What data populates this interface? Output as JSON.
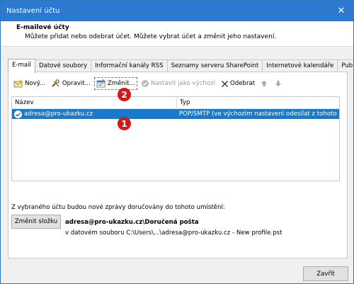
{
  "window": {
    "title": "Nastavení účtu"
  },
  "header": {
    "title": "E-mailové účty",
    "subtitle": "Můžete přidat nebo odebrat účet. Můžete vybrat účet a změnit jeho nastavení."
  },
  "tabs": [
    {
      "label": "E-mail",
      "active": true
    },
    {
      "label": "Datové soubory"
    },
    {
      "label": "Informační kanály RSS"
    },
    {
      "label": "Seznamy serveru SharePoint"
    },
    {
      "label": "Internetové kalendáře"
    },
    {
      "label": "Publi"
    }
  ],
  "toolbar": {
    "new_label": "Nový...",
    "repair_label": "Opravit...",
    "change_label": "Změnit...",
    "set_default_label": "Nastavit jako výchozí",
    "remove_label": "Odebrat"
  },
  "list": {
    "col_name": "Název",
    "col_type": "Typ",
    "rows": [
      {
        "name": "adresa@pro-ukazku.cz",
        "type": "POP/SMTP (ve výchozím nastavení odesílat z tohoto ..."
      }
    ]
  },
  "delivery": {
    "label": "Z vybraného účtu budou nové zprávy doručovány do tohoto umístění:",
    "change_folder_label": "Změnit složku",
    "folder": "adresa@pro-ukazku.cz\\Doručená pošta",
    "path": "v datovém souboru C:\\Users\\...\\adresa@pro-ukazku.cz - New profile.pst"
  },
  "footer": {
    "close_label": "Zavřít"
  },
  "callouts": {
    "one": "1",
    "two": "2"
  },
  "colors": {
    "titlebar": "#2b79d0",
    "selection": "#1979ca",
    "callout": "#d11b1b"
  }
}
